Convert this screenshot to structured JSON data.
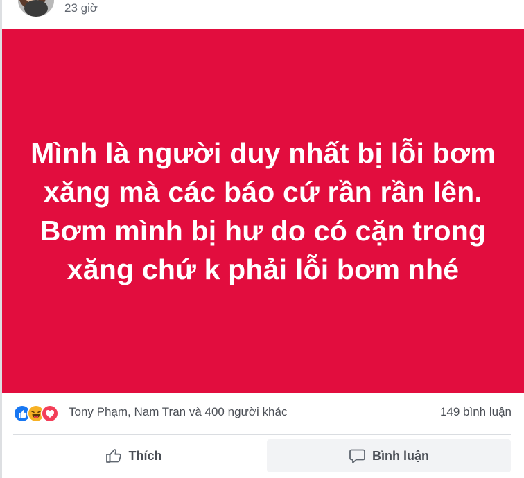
{
  "header": {
    "timestamp": "23 giờ"
  },
  "post": {
    "background_color": "#e20d3e",
    "text": "Mình là người duy nhất bị lỗi bơm xăng mà các báo cứ rần rần lên. Bơm mình bị hư do có cặn trong xăng chứ k phải lỗi bơm nhé"
  },
  "reactions": {
    "icons": [
      "like-icon",
      "haha-icon",
      "love-icon"
    ],
    "likers_text": "Tony Phạm, Nam Tran và 400 người khác",
    "comments_count": "149 bình luận"
  },
  "actions": {
    "like_label": "Thích",
    "comment_label": "Bình luận"
  }
}
